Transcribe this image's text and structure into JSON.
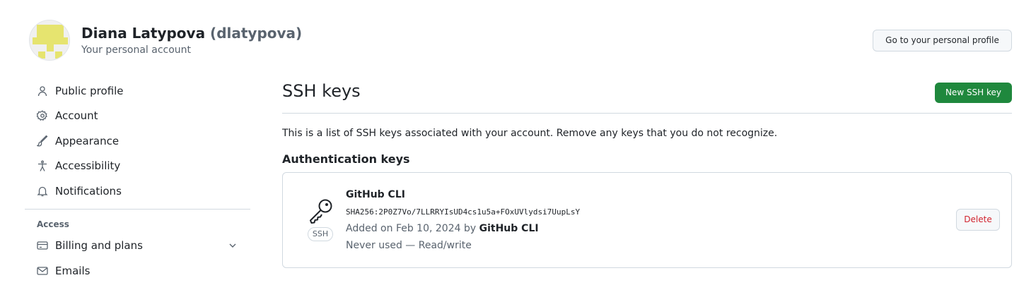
{
  "header": {
    "name": "Diana Latypova",
    "username": "(dlatypova)",
    "subtitle": "Your personal account",
    "profile_button": "Go to your personal profile"
  },
  "sidebar": {
    "items": [
      {
        "label": "Public profile",
        "icon": "person-icon"
      },
      {
        "label": "Account",
        "icon": "gear-icon"
      },
      {
        "label": "Appearance",
        "icon": "paintbrush-icon"
      },
      {
        "label": "Accessibility",
        "icon": "accessibility-icon"
      },
      {
        "label": "Notifications",
        "icon": "bell-icon"
      }
    ],
    "access_heading": "Access",
    "access_items": [
      {
        "label": "Billing and plans",
        "icon": "credit-card-icon"
      },
      {
        "label": "Emails",
        "icon": "mail-icon"
      }
    ]
  },
  "main": {
    "title": "SSH keys",
    "new_button": "New SSH key",
    "description": "This is a list of SSH keys associated with your account. Remove any keys that you do not recognize.",
    "section_title": "Authentication keys",
    "key": {
      "title": "GitHub CLI",
      "fingerprint": "SHA256:2P0Z7Vo/7LLRRYIsUD4cs1u5a+FOxUVlydsi7UupLsY",
      "added_prefix": "Added on Feb 10, 2024 by",
      "added_by": "GitHub CLI",
      "usage": "Never used — Read/write",
      "type_label": "SSH",
      "delete_button": "Delete"
    }
  },
  "colors": {
    "primary_button": "#1f883d",
    "danger": "#d1242f",
    "muted": "#59636e",
    "border": "#d1d9e0",
    "avatar": "#e6e46f"
  }
}
